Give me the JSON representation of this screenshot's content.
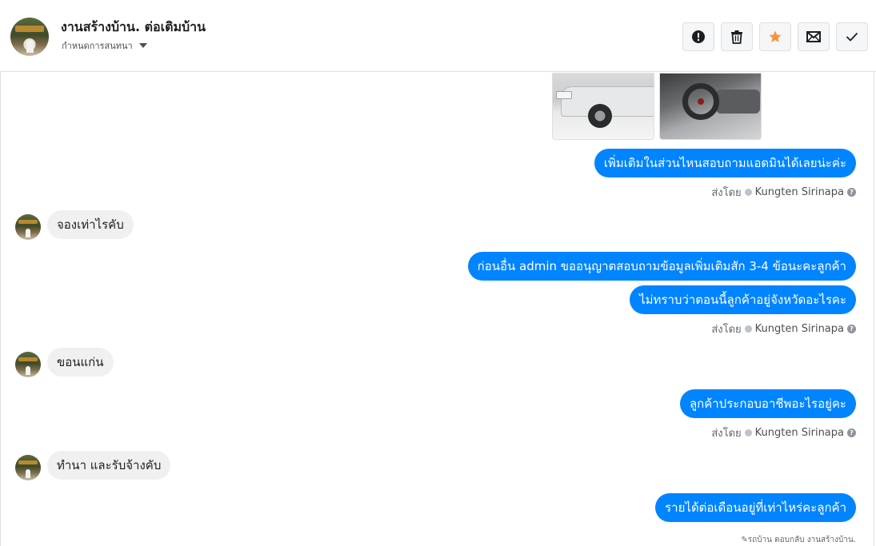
{
  "header": {
    "title": "งานสร้างบ้าน. ต่อเติมบ้าน",
    "assign_label": "กำหนดการสนทนา",
    "actions": [
      {
        "name": "alert-button",
        "icon": "exclamation-icon"
      },
      {
        "name": "delete-button",
        "icon": "trash-icon"
      },
      {
        "name": "star-button",
        "icon": "star-icon",
        "color": "#f7923b"
      },
      {
        "name": "unread-button",
        "icon": "envelope-icon"
      },
      {
        "name": "done-button",
        "icon": "checkmark-icon"
      }
    ]
  },
  "attachments": [
    {
      "name": "photo-truck-exterior"
    },
    {
      "name": "photo-truck-interior"
    }
  ],
  "messages": {
    "m1": "เพิ่มเติมในส่วนไหนสอบถามแอดมินได้เลยน่ะค่ะ",
    "m2": "จองเท่าไรคับ",
    "m3": "ก่อนอื่น admin ขออนุญาตสอบถามข้อมูลเพิ่มเติมสัก 3-4 ข้อนะคะลูกค้า",
    "m4": "ไม่ทราบว่าตอนนี้ลูกค้าอยู่จังหวัดอะไรคะ",
    "m5": "ขอนแก่น",
    "m6": "ลูกค้าประกอบอาชีพอะไรอยู่คะ",
    "m7": "ทำนา  และรับจ้างคับ",
    "m8": "รายได้ต่อเดือนอยู่ที่เท่าไหร่คะลูกค้า"
  },
  "sent_by": {
    "prefix": "ส่งโดย",
    "name": "Kungten Sirinapa",
    "help": "?"
  },
  "footer_note": "รถบ้าน ตอบกลับ งานสร้างบ้าน.",
  "colors": {
    "outgoing_bubble": "#0084ff",
    "incoming_bubble": "#f1f0f0",
    "star": "#f7923b"
  }
}
